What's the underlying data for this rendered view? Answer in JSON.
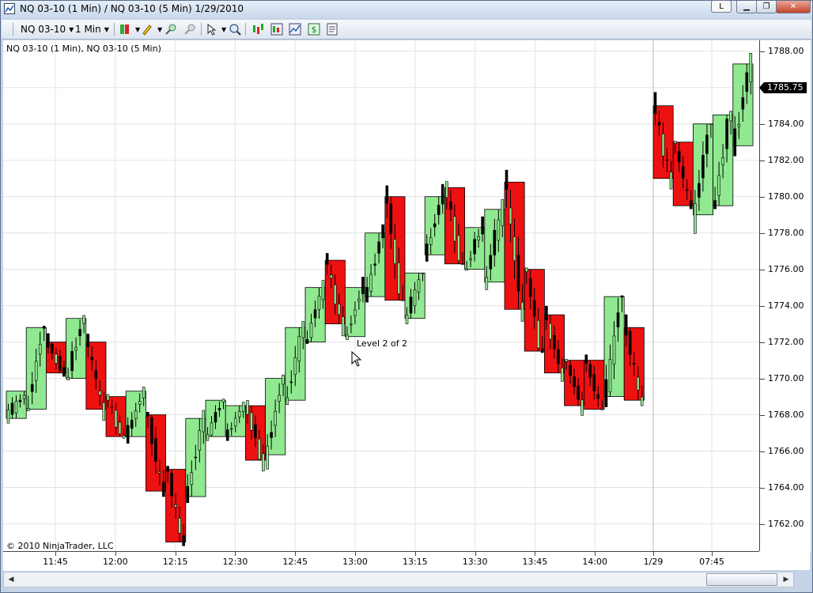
{
  "window": {
    "title": "NQ 03-10 (1 Min) / NQ 03-10 (5 Min)  1/29/2010",
    "link_button": "L"
  },
  "toolbar": {
    "instrument": "NQ 03-10",
    "interval": "1 Min"
  },
  "chart": {
    "header": "NQ 03-10 (1 Min), NQ 03-10 (5 Min)",
    "copyright": "© 2010 NinjaTrader, LLC",
    "annotation": "Level 2 of 2",
    "last_price": "1785.75",
    "colors": {
      "up_box": "#90e890",
      "down_box": "#ee1111",
      "wick": "#000000",
      "grid": "#e3e3e3"
    }
  },
  "chart_data": {
    "type": "candlestick",
    "ylim": [
      1760.5,
      1788.6
    ],
    "price_ticks": [
      "1788.00",
      "1786.00",
      "1784.00",
      "1782.00",
      "1780.00",
      "1778.00",
      "1776.00",
      "1774.00",
      "1772.00",
      "1770.00",
      "1768.00",
      "1766.00",
      "1764.00",
      "1762.00"
    ],
    "time_ticks": [
      "11:45",
      "12:00",
      "12:15",
      "12:30",
      "12:45",
      "13:00",
      "13:15",
      "13:30",
      "13:45",
      "14:00",
      "1/29",
      "07:45"
    ],
    "five_min_bars": [
      {
        "o": 1768.0,
        "c": 1769.0,
        "h": 1769.3,
        "l": 1767.8
      },
      {
        "o": 1768.3,
        "c": 1772.8,
        "h": 1772.8,
        "l": 1768.3
      },
      {
        "o": 1772.0,
        "c": 1770.3,
        "h": 1772.0,
        "l": 1770.3
      },
      {
        "o": 1770.0,
        "c": 1773.3,
        "h": 1773.3,
        "l": 1770.0
      },
      {
        "o": 1772.0,
        "c": 1768.3,
        "h": 1772.0,
        "l": 1768.3
      },
      {
        "o": 1769.0,
        "c": 1766.8,
        "h": 1769.0,
        "l": 1766.8
      },
      {
        "o": 1766.8,
        "c": 1769.3,
        "h": 1769.3,
        "l": 1766.8
      },
      {
        "o": 1768.0,
        "c": 1763.8,
        "h": 1768.0,
        "l": 1763.8
      },
      {
        "o": 1765.0,
        "c": 1761.0,
        "h": 1765.0,
        "l": 1761.0
      },
      {
        "o": 1763.5,
        "c": 1767.8,
        "h": 1767.8,
        "l": 1763.5
      },
      {
        "o": 1766.8,
        "c": 1768.8,
        "h": 1768.8,
        "l": 1766.8
      },
      {
        "o": 1766.8,
        "c": 1768.5,
        "h": 1768.5,
        "l": 1766.8
      },
      {
        "o": 1768.5,
        "c": 1765.5,
        "h": 1768.5,
        "l": 1765.5
      },
      {
        "o": 1765.8,
        "c": 1770.0,
        "h": 1770.0,
        "l": 1765.8
      },
      {
        "o": 1768.8,
        "c": 1772.8,
        "h": 1772.8,
        "l": 1768.8
      },
      {
        "o": 1772.0,
        "c": 1775.0,
        "h": 1775.0,
        "l": 1772.0
      },
      {
        "o": 1776.5,
        "c": 1773.0,
        "h": 1776.5,
        "l": 1773.0
      },
      {
        "o": 1772.3,
        "c": 1775.0,
        "h": 1775.0,
        "l": 1772.3
      },
      {
        "o": 1774.5,
        "c": 1778.0,
        "h": 1778.0,
        "l": 1774.5
      },
      {
        "o": 1780.0,
        "c": 1774.3,
        "h": 1780.0,
        "l": 1774.3
      },
      {
        "o": 1773.3,
        "c": 1775.8,
        "h": 1775.8,
        "l": 1773.3
      },
      {
        "o": 1776.8,
        "c": 1780.0,
        "h": 1780.0,
        "l": 1776.8
      },
      {
        "o": 1780.5,
        "c": 1776.3,
        "h": 1780.5,
        "l": 1776.3
      },
      {
        "o": 1776.0,
        "c": 1778.3,
        "h": 1778.3,
        "l": 1776.0
      },
      {
        "o": 1775.3,
        "c": 1779.3,
        "h": 1779.3,
        "l": 1775.3
      },
      {
        "o": 1780.8,
        "c": 1773.8,
        "h": 1780.8,
        "l": 1773.8
      },
      {
        "o": 1776.0,
        "c": 1771.5,
        "h": 1776.0,
        "l": 1771.5
      },
      {
        "o": 1773.5,
        "c": 1770.3,
        "h": 1773.5,
        "l": 1770.3
      },
      {
        "o": 1771.0,
        "c": 1768.5,
        "h": 1771.0,
        "l": 1768.5
      },
      {
        "o": 1771.0,
        "c": 1768.3,
        "h": 1771.0,
        "l": 1768.3
      },
      {
        "o": 1769.0,
        "c": 1774.5,
        "h": 1774.5,
        "l": 1769.0
      },
      {
        "o": 1772.8,
        "c": 1768.8,
        "h": 1772.8,
        "l": 1768.8
      },
      {
        "o": 1785.0,
        "c": 1781.0,
        "h": 1785.0,
        "l": 1781.0
      },
      {
        "o": 1783.0,
        "c": 1779.5,
        "h": 1783.0,
        "l": 1779.5
      },
      {
        "o": 1779.0,
        "c": 1784.0,
        "h": 1784.0,
        "l": 1779.0
      },
      {
        "o": 1779.5,
        "c": 1784.5,
        "h": 1784.5,
        "l": 1779.5
      },
      {
        "o": 1782.8,
        "c": 1787.3,
        "h": 1787.3,
        "l": 1782.8
      }
    ]
  }
}
